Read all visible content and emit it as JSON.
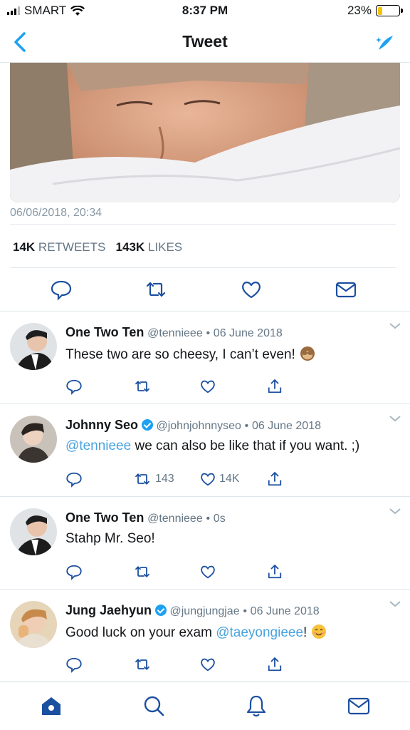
{
  "status_bar": {
    "carrier": "SMART",
    "time": "8:37 PM",
    "battery": "23%",
    "battery_level": 0.23
  },
  "nav": {
    "title": "Tweet"
  },
  "tweet": {
    "timestamp": "06/06/2018, 20:34",
    "retweets_count": "14K",
    "retweets_label": "RETWEETS",
    "likes_count": "143K",
    "likes_label": "LIKES"
  },
  "replies": [
    {
      "name": "One Two Ten",
      "handle": "@tennieee",
      "time": "06 June 2018",
      "verified": false,
      "text": "These two are so cheesy, I can’t even!",
      "retweets": "",
      "likes": ""
    },
    {
      "name": "Johnny Seo",
      "handle": "@johnjohnnyseo",
      "time": "06 June 2018",
      "verified": true,
      "mention": "@tennieee",
      "text": " we can also be like that if you want. ;)",
      "retweets": "143",
      "likes": "14K"
    },
    {
      "name": "One Two Ten",
      "handle": "@tennieee",
      "time": "0s",
      "verified": false,
      "text": "Stahp Mr. Seo!",
      "retweets": "",
      "likes": ""
    },
    {
      "name": "Jung Jaehyun",
      "handle": "@jungjungjae",
      "time": "06 June 2018",
      "verified": true,
      "text_before": "Good luck on your exam ",
      "mention": "@taeyongieee",
      "text_after": "!",
      "retweets": "",
      "likes": ""
    }
  ],
  "separator": "•",
  "colors": {
    "accent": "#1da1f2",
    "link": "#4aa3df",
    "muted": "#657786",
    "tab_active": "#1b4fa0"
  },
  "icons": [
    "back-chevron-icon",
    "compose-sparkle-icon",
    "reply-icon",
    "retweet-icon",
    "like-icon",
    "dm-icon",
    "share-icon",
    "home-icon",
    "search-icon",
    "notifications-icon",
    "messages-icon"
  ]
}
